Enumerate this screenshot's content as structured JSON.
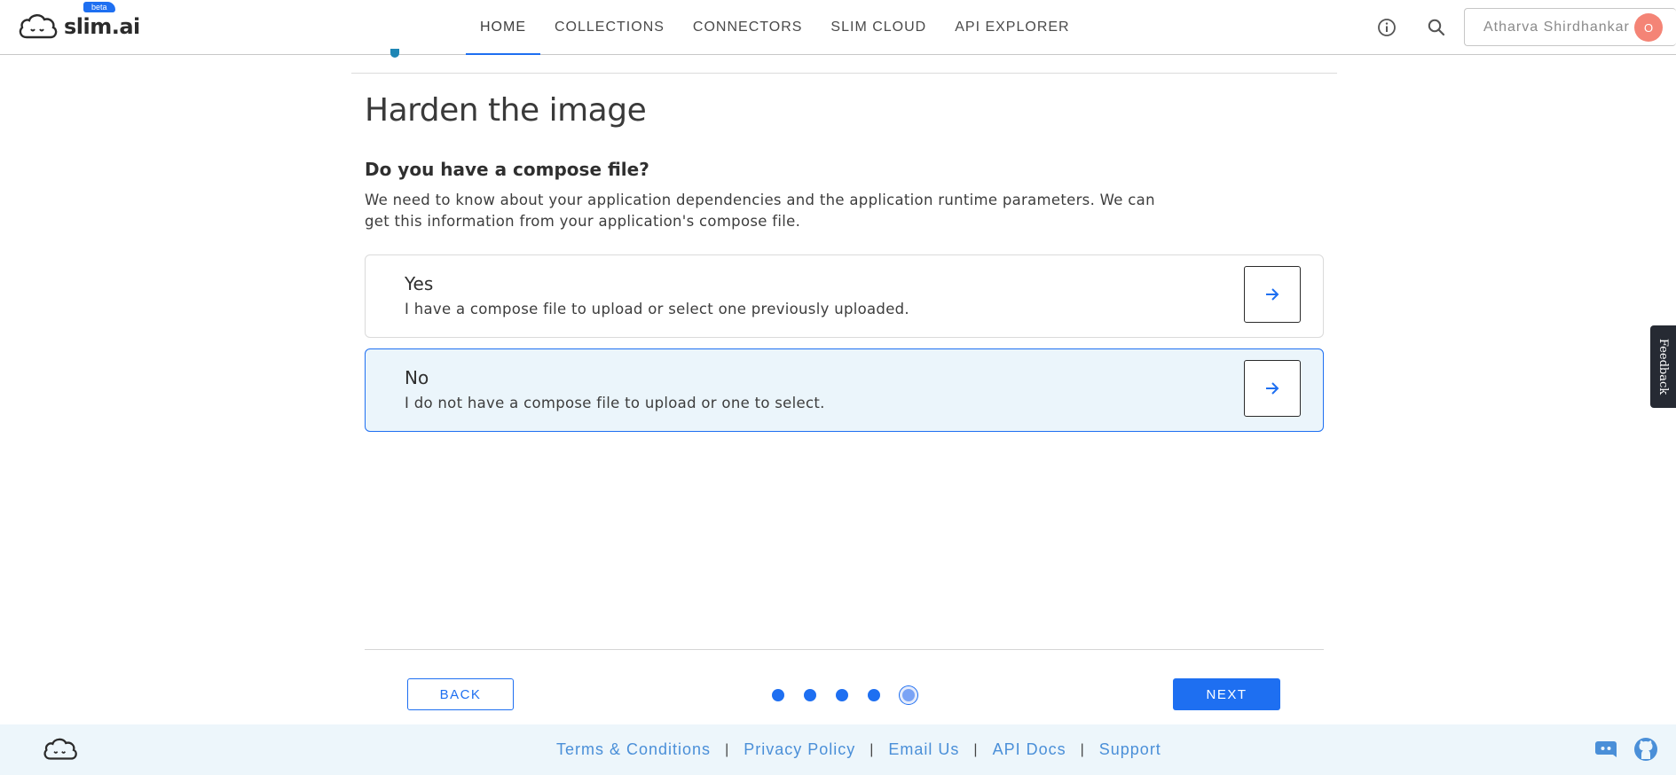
{
  "header": {
    "logo_text": "slim.ai",
    "beta_label": "beta",
    "nav": [
      {
        "label": "HOME",
        "active": true
      },
      {
        "label": "COLLECTIONS",
        "active": false
      },
      {
        "label": "CONNECTORS",
        "active": false
      },
      {
        "label": "SLIM CLOUD",
        "active": false
      },
      {
        "label": "API EXPLORER",
        "active": false
      }
    ],
    "icons": [
      "info-icon",
      "search-icon"
    ],
    "user": {
      "name": "Atharva Shirdhankar",
      "avatar_initial": "O",
      "avatar_color": "#f48476"
    }
  },
  "main": {
    "title": "Harden the image",
    "question": "Do you have a compose file?",
    "description": "We need to know about your application dependencies and the application runtime parameters. We can get this information from your application's compose file.",
    "options": [
      {
        "title": "Yes",
        "description": "I have a compose file to upload or select one previously uploaded.",
        "selected": false
      },
      {
        "title": "No",
        "description": "I do not have a compose file to upload or one to select.",
        "selected": true
      }
    ]
  },
  "wizard": {
    "back_label": "BACK",
    "next_label": "NEXT",
    "total_steps": 5,
    "current_step": 5
  },
  "footer": {
    "links": [
      "Terms & Conditions",
      "Privacy Policy",
      "Email Us",
      "API Docs",
      "Support"
    ],
    "separator": "|",
    "icons": [
      "discord-icon",
      "github-icon"
    ]
  },
  "feedback_label": "Feedback",
  "colors": {
    "accent": "#1e6ff1",
    "selected_bg": "#ebf5fb",
    "footer_bg": "#edf6fb",
    "footer_link": "#4a8fd8"
  }
}
